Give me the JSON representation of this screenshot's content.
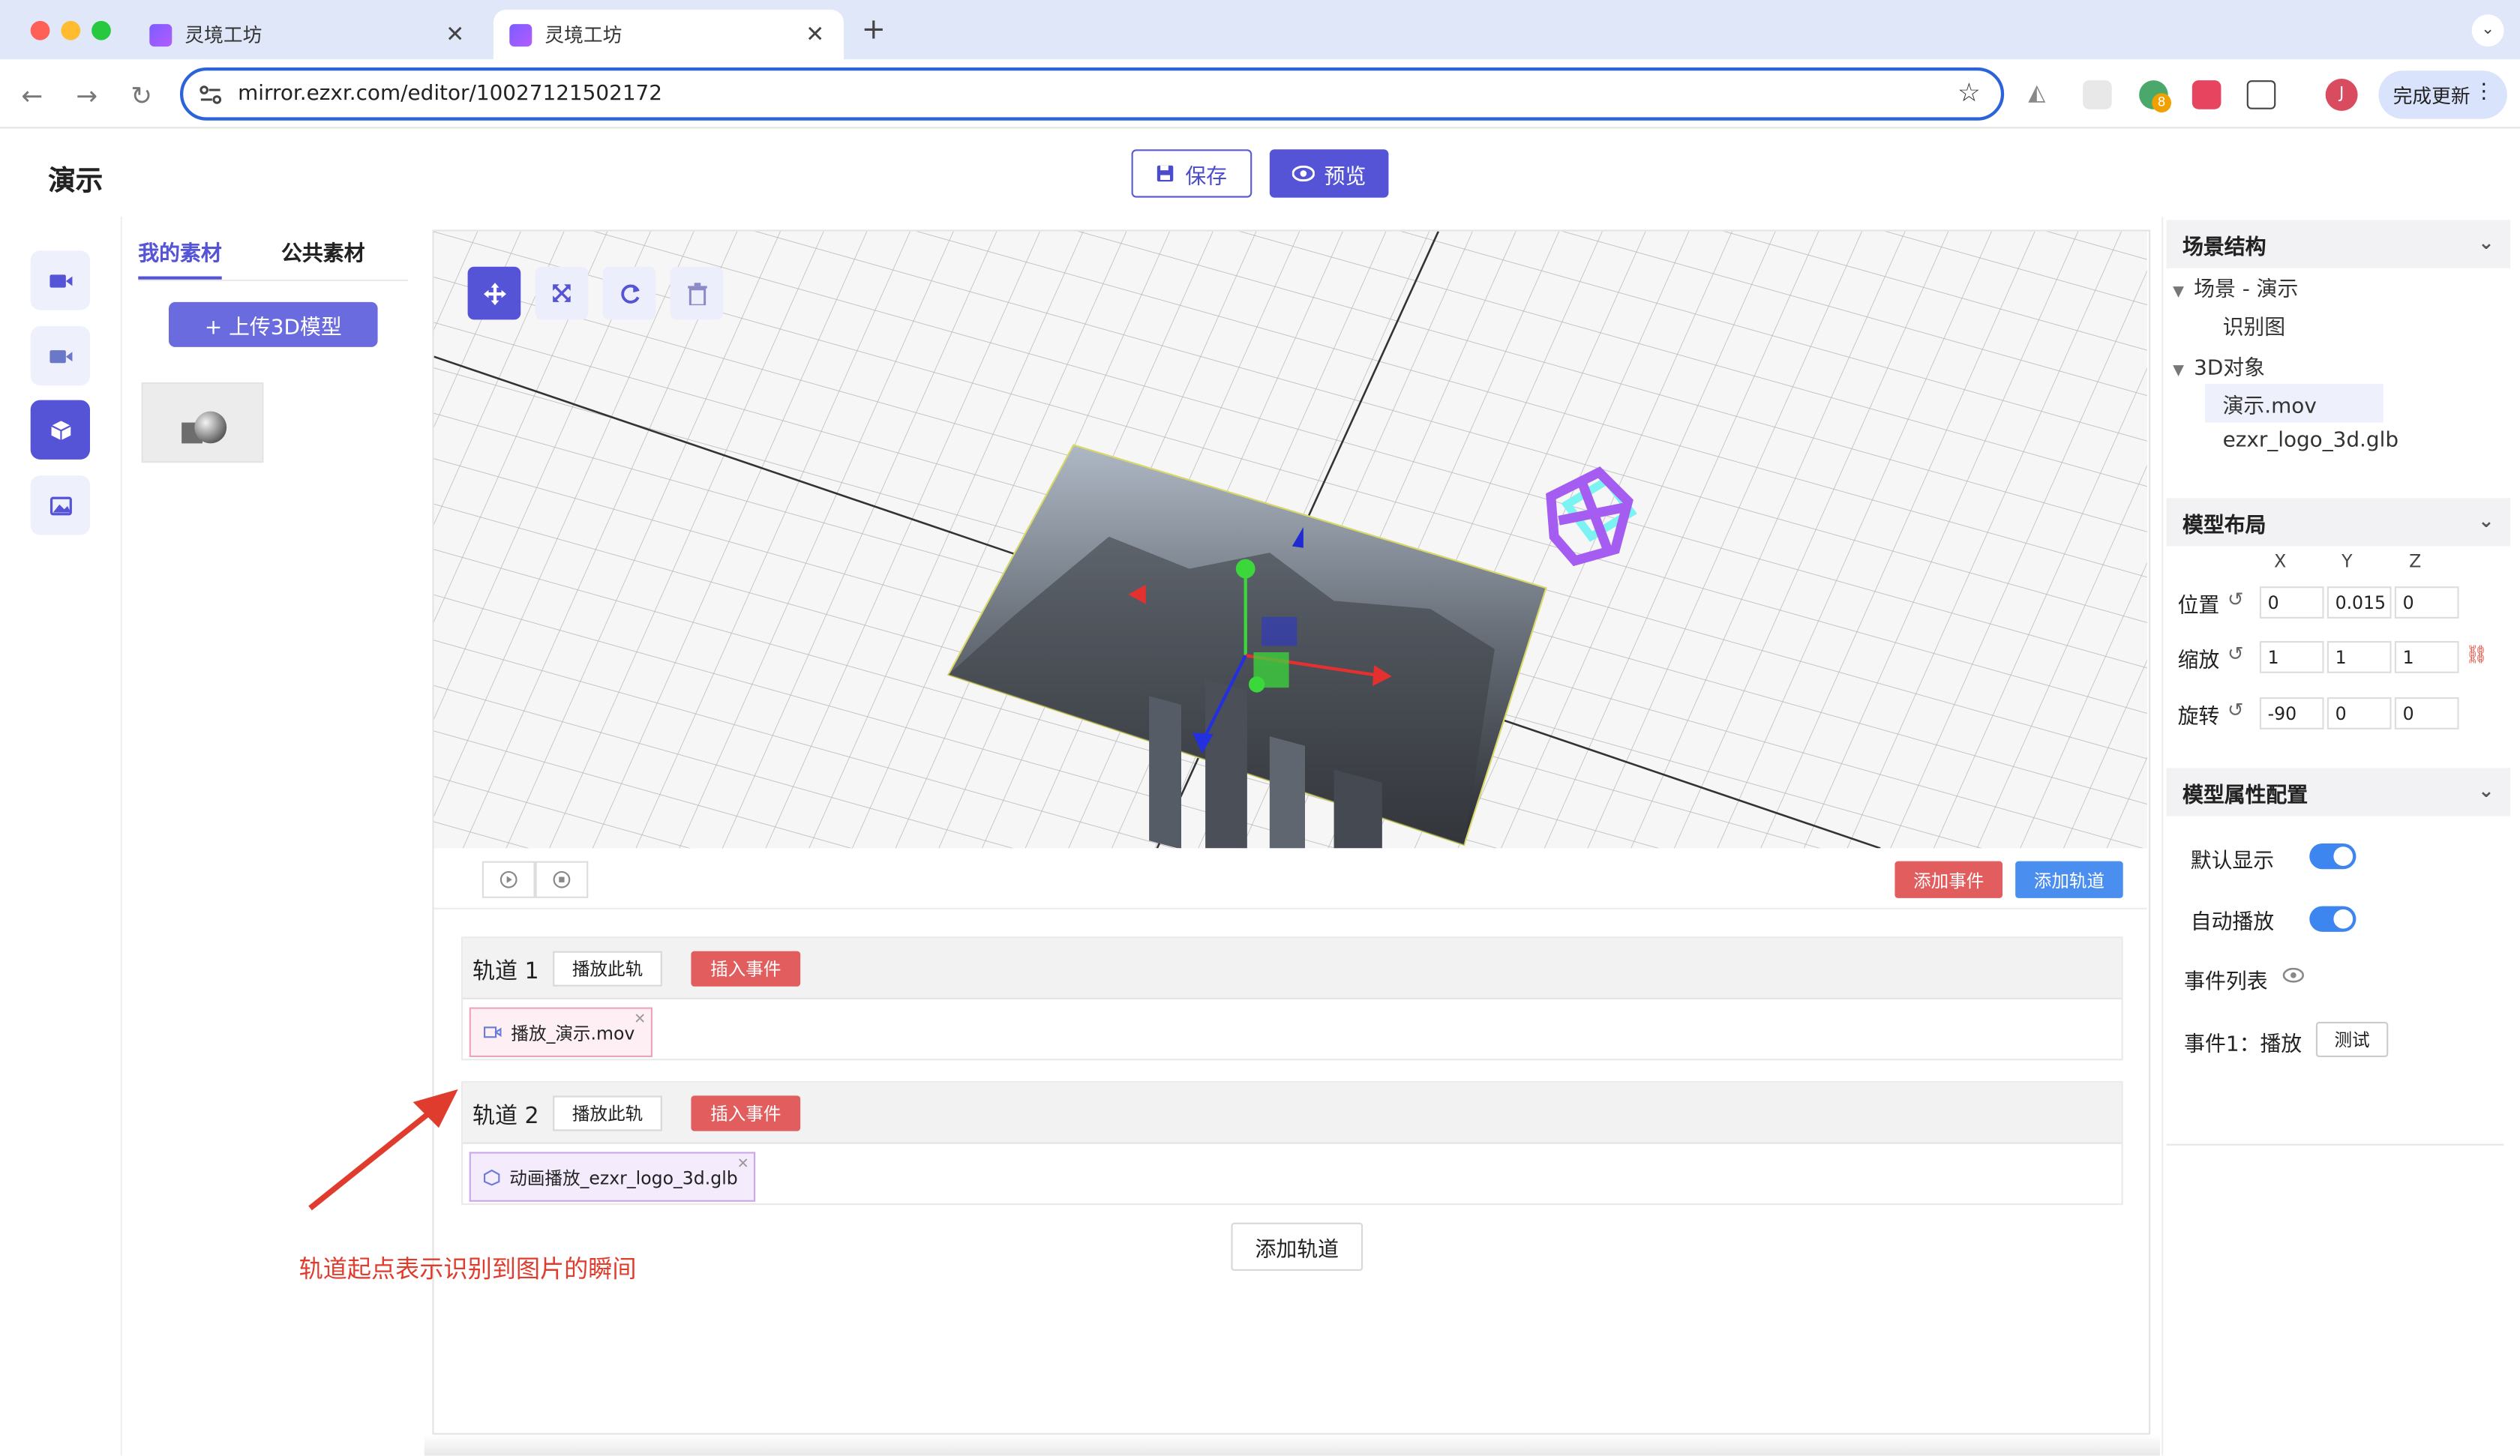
{
  "browser": {
    "tabs": [
      {
        "label": "灵境工坊",
        "active": false
      },
      {
        "label": "灵境工坊",
        "active": true
      }
    ],
    "url": "mirror.ezxr.com/editor/10027121502172",
    "update_label": "完成更新",
    "profile_initial": "J",
    "extension_badge": "8"
  },
  "header": {
    "title": "演示",
    "save_label": "保存",
    "preview_label": "预览"
  },
  "assets": {
    "tabs": [
      "我的素材",
      "公共素材"
    ],
    "upload_label": "+ 上传3D模型"
  },
  "timeline": {
    "add_event_label": "添加事件",
    "add_track_label": "添加轨道",
    "tracks": [
      {
        "name": "轨道 1",
        "play_label": "播放此轨",
        "insert_label": "插入事件",
        "clip": "播放_演示.mov"
      },
      {
        "name": "轨道 2",
        "play_label": "播放此轨",
        "insert_label": "插入事件",
        "clip": "动画播放_ezxr_logo_3d.glb"
      }
    ],
    "bottom_add_track_label": "添加轨道",
    "annotation": "轨道起点表示识别到图片的瞬间"
  },
  "scene": {
    "header": "场景结构",
    "root": "场景 - 演示",
    "image_target": "识别图",
    "objects_group": "3D对象",
    "objects": [
      "演示.mov",
      "ezxr_logo_3d.glb"
    ],
    "selected": "演示.mov"
  },
  "layout_panel": {
    "header": "模型布局",
    "axes": [
      "X",
      "Y",
      "Z"
    ],
    "rows": [
      {
        "label": "位置",
        "values": [
          "0",
          "0.015",
          "0"
        ]
      },
      {
        "label": "缩放",
        "values": [
          "1",
          "1",
          "1"
        ]
      },
      {
        "label": "旋转",
        "values": [
          "-90",
          "0",
          "0"
        ]
      }
    ]
  },
  "props": {
    "header": "模型属性配置",
    "default_show_label": "默认显示",
    "default_show": true,
    "autoplay_label": "自动播放",
    "autoplay": true,
    "event_list_label": "事件列表",
    "event1_label": "事件1：播放",
    "test_label": "测试"
  },
  "colors": {
    "accent": "#5553d6",
    "danger": "#e25d5d",
    "info": "#4a8ef0",
    "annotation": "#e03c2d"
  }
}
